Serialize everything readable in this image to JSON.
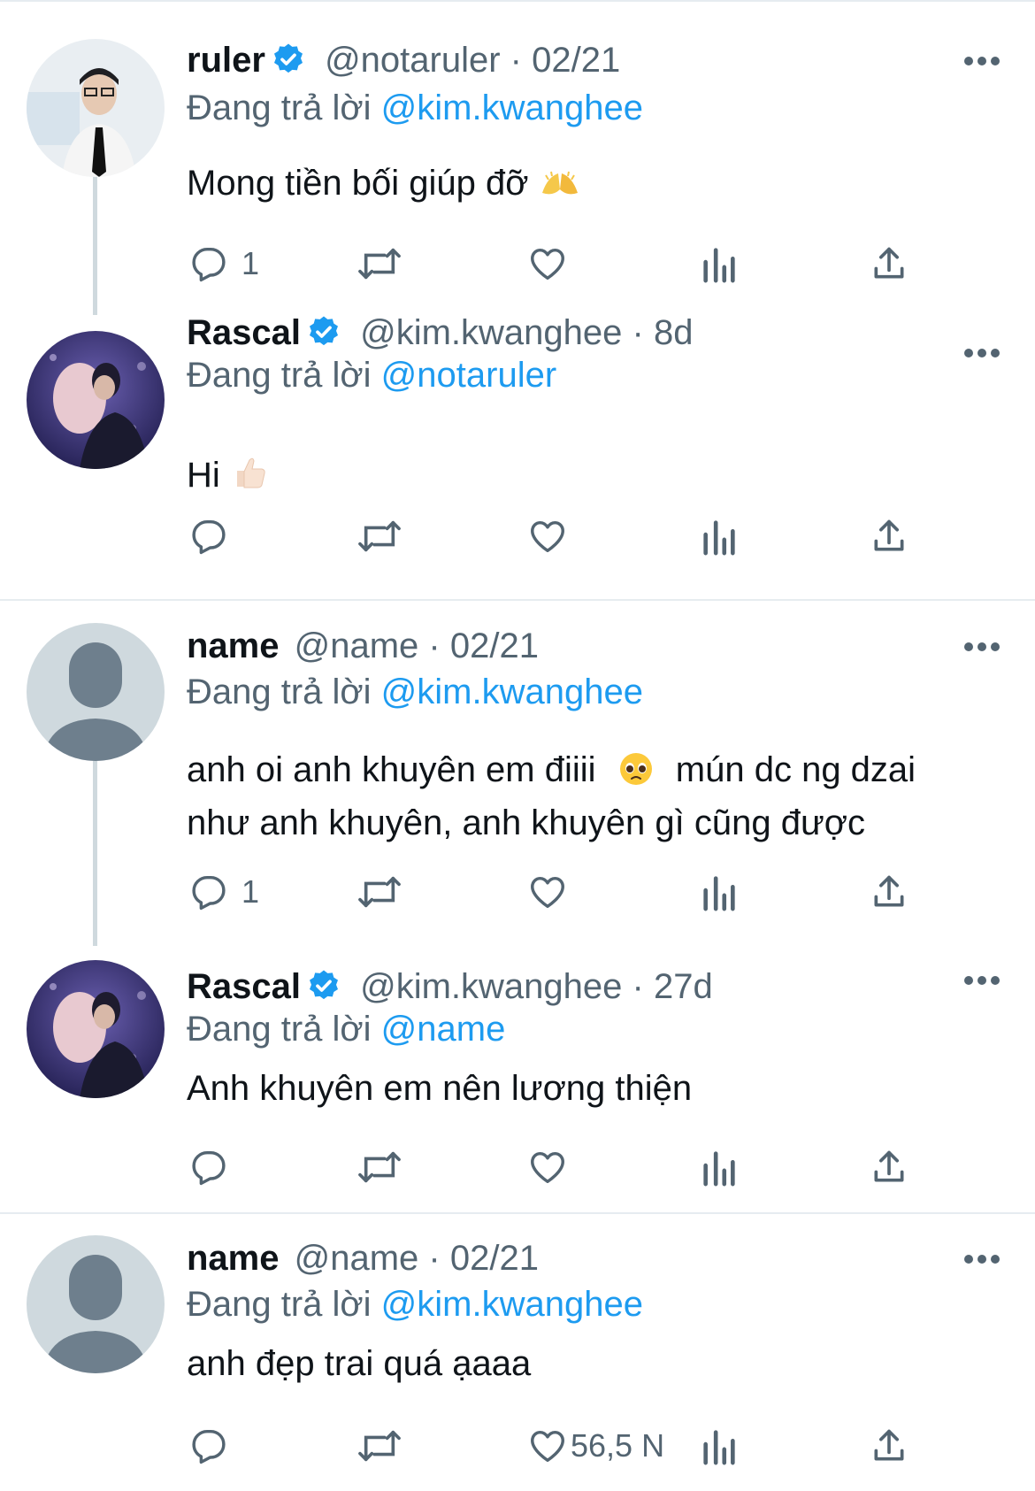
{
  "replying_prefix": "Đang trả lời",
  "tweets": [
    {
      "display_name": "ruler",
      "verified": true,
      "handle": "@notaruler",
      "sep": "·",
      "time": "02/21",
      "reply_to": "@kim.kwanghee",
      "text": "Mong tiền bối giúp đỡ",
      "emoji": "folded-hands-emoji",
      "reply_count": "1",
      "like_count": ""
    },
    {
      "display_name": "Rascal",
      "verified": true,
      "handle": "@kim.kwanghee",
      "sep": "·",
      "time": "8d",
      "reply_to": "@notaruler",
      "text": "Hi",
      "emoji": "thumbs-up-emoji",
      "reply_count": "",
      "like_count": ""
    },
    {
      "display_name": "name",
      "verified": false,
      "handle": "@name",
      "sep": "·",
      "time": "02/21",
      "reply_to": "@kim.kwanghee",
      "text_part1": "anh oi anh khuyên em điiii",
      "text_part2": "mún dc ng dzai",
      "text_line2": "như anh khuyên, anh khuyên gì cũng được",
      "emoji": "pleading-face-emoji",
      "reply_count": "1",
      "like_count": ""
    },
    {
      "display_name": "Rascal",
      "verified": true,
      "handle": "@kim.kwanghee",
      "sep": "·",
      "time": "27d",
      "reply_to": "@name",
      "text": "Anh khuyên em nên lương thiện",
      "reply_count": "",
      "like_count": ""
    },
    {
      "display_name": "name",
      "verified": false,
      "handle": "@name",
      "sep": "·",
      "time": "02/21",
      "reply_to": "@kim.kwanghee",
      "text": "anh đẹp trai quá ạaaa",
      "reply_count": "",
      "like_count": "56,5 N"
    }
  ],
  "icons": {
    "reply": "reply-bubble-icon",
    "retweet": "retweet-icon",
    "like": "heart-icon",
    "analytics": "bar-chart-icon",
    "share": "share-icon",
    "more": "more-dots-icon",
    "verified": "verified-badge-icon"
  },
  "colors": {
    "accent": "#1d9bf0",
    "secondary": "#536471",
    "divider": "#e6ecf0",
    "thread_line": "#cfd9de"
  }
}
